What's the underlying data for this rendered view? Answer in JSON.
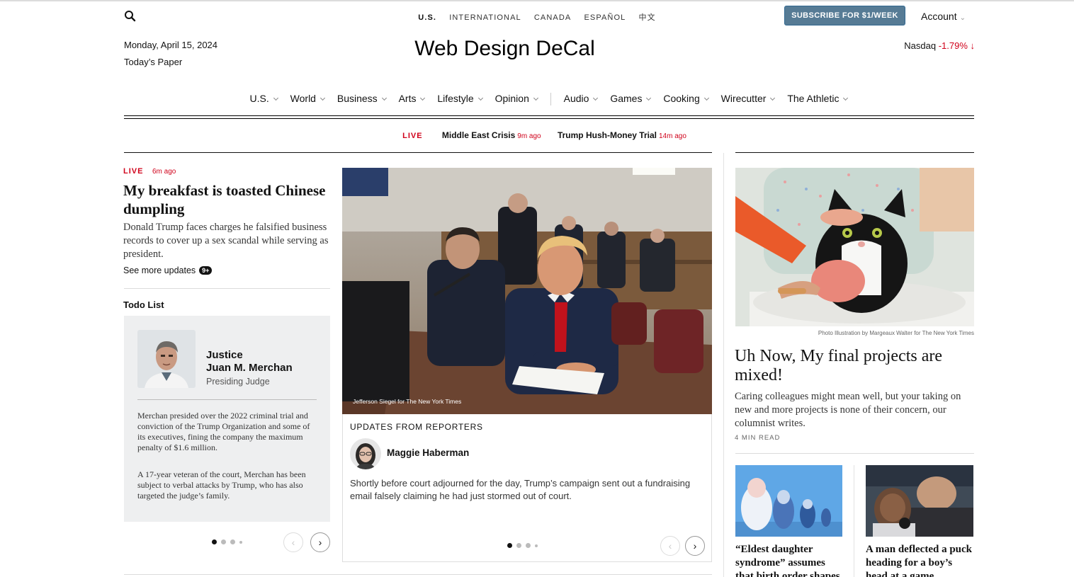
{
  "top_bar": {
    "editions": [
      "U.S.",
      "INTERNATIONAL",
      "CANADA",
      "ESPAÑOL",
      "中文"
    ],
    "subscribe_label": "SUBSCRIBE FOR $1/WEEK",
    "account_label": "Account"
  },
  "header": {
    "date": "Monday, April 15, 2024",
    "todays_paper": "Today’s Paper",
    "masthead": "Web Design DeCal",
    "nasdaq_label": "Nasdaq",
    "nasdaq_change": "-1.79% ↓"
  },
  "nav": {
    "items": [
      "U.S.",
      "World",
      "Business",
      "Arts",
      "Lifestyle",
      "Opinion",
      "Audio",
      "Games",
      "Cooking",
      "Wirecutter",
      "The Athletic"
    ]
  },
  "live_bar": {
    "live_label": "LIVE",
    "stories": [
      {
        "title": "Middle East Crisis",
        "ago": "9m ago"
      },
      {
        "title": "Trump Hush-Money Trial",
        "ago": "14m ago"
      }
    ]
  },
  "lead": {
    "live_label": "LIVE",
    "ago": "6m ago",
    "headline": "My breakfast is toasted Chinese dumpling",
    "summary": "Donald Trump faces charges he falsified business records to cover up a sex scandal while serving as president.",
    "see_more": "See more updates",
    "badge": "9+"
  },
  "todo": {
    "title": "Todo List",
    "name_line1": "Justice",
    "name_line2": "Juan M. Merchan",
    "role": "Presiding Judge",
    "p1": "Merchan presided over the 2022 criminal trial and conviction of the Trump Organization and some of its executives, fining the company the maximum penalty of $1.6 million.",
    "p2": "A 17-year veteran of the court, Merchan has been subject to verbal attacks by Trump, who has also targeted the judge’s family."
  },
  "center": {
    "photo_credit": "Jefferson Siegel for The New York Times",
    "updates_label": "UPDATES FROM REPORTERS",
    "reporter": "Maggie Haberman",
    "update_text": "Shortly before court adjourned for the day, Trump’s campaign sent out a fundraising email falsely claiming he had just stormed out of court."
  },
  "right": {
    "photo_credit": "Photo Illustration by Margeaux Walter for The New York Times",
    "headline": "Uh Now, My final projects are mixed!",
    "summary": "Caring colleagues might mean well, but your taking on new and more projects is none of their concern, our columnist writes.",
    "read_time": "4 MIN READ",
    "small1": "“Eldest daughter syndrome” assumes that birth order shapes",
    "small2": "A man deflected a puck heading for a boy’s head at a game"
  },
  "colors": {
    "accent_red": "#d0021b",
    "subscribe_bg": "#567b95"
  }
}
